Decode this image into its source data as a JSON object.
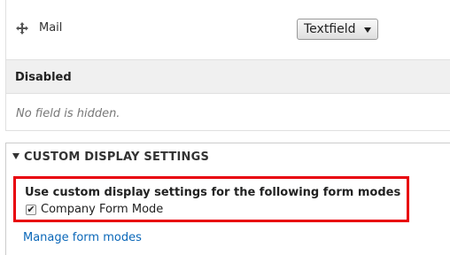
{
  "field_row": {
    "label": "Mail",
    "drag_icon": "move-cross-icon",
    "widget": {
      "selected": "Textfield"
    }
  },
  "disabled_region": {
    "title": "Disabled",
    "message": "No field is hidden."
  },
  "custom_display": {
    "summary": "CUSTOM DISPLAY SETTINGS",
    "expanded": true,
    "legend": "Use custom display settings for the following form modes",
    "checkbox": {
      "label": "Company Form Mode",
      "checked": true,
      "glyph": "✔"
    },
    "manage_link": "Manage form modes"
  },
  "colors": {
    "highlight": "#e8000b",
    "link": "#0a67b8",
    "region_bg": "#f0f0f0"
  }
}
